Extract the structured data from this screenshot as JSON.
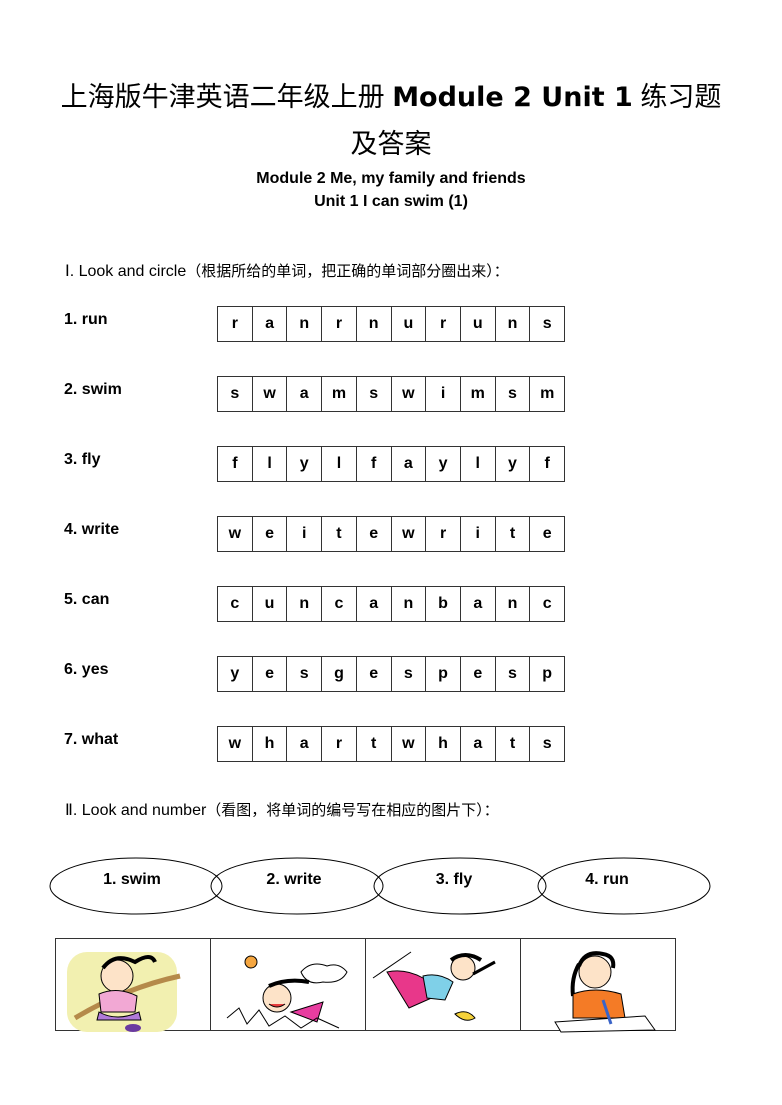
{
  "title": {
    "cn_prefix": "上海版牛津英语二年级上册",
    "latin": "Module 2 Unit 1",
    "cn_suffix": "练习题",
    "line2": "及答案"
  },
  "subtitle": {
    "module": "Module 2    Me, my family and friends",
    "unit": "Unit 1 I can swim (1)"
  },
  "section1": {
    "numeral": "Ⅰ. ",
    "instruction": "Look and circle",
    "cn_note": "（根据所给的单词，把正确的单词部分圈出来）："
  },
  "exercises": [
    {
      "label": "1. run",
      "letters": [
        "r",
        "a",
        "n",
        "r",
        "n",
        "u",
        "r",
        "u",
        "n",
        "s"
      ]
    },
    {
      "label": "2. swim",
      "letters": [
        "s",
        "w",
        "a",
        "m",
        "s",
        "w",
        "i",
        "m",
        "s",
        "m"
      ]
    },
    {
      "label": "3. fly",
      "letters": [
        "f",
        "l",
        "y",
        "l",
        "f",
        "a",
        "y",
        "l",
        "y",
        "f"
      ]
    },
    {
      "label": "4. write",
      "letters": [
        "w",
        "e",
        "i",
        "t",
        "e",
        "w",
        "r",
        "i",
        "t",
        "e"
      ]
    },
    {
      "label": "5. can",
      "letters": [
        "c",
        "u",
        "n",
        "c",
        "a",
        "n",
        "b",
        "a",
        "n",
        "c"
      ]
    },
    {
      "label": "6. yes",
      "letters": [
        "y",
        "e",
        "s",
        "g",
        "e",
        "s",
        "p",
        "e",
        "s",
        "p"
      ]
    },
    {
      "label": "7. what",
      "letters": [
        "w",
        "h",
        "a",
        "r",
        "t",
        "w",
        "h",
        "a",
        "t",
        "s"
      ]
    }
  ],
  "section2": {
    "numeral": "Ⅱ. ",
    "instruction": "Look and number",
    "cn_note": "（看图，将单词的编号写在相应的图片下）："
  },
  "ovals": [
    "1. swim",
    "2. write",
    "3. fly",
    "4. run"
  ],
  "pictures": [
    {
      "icon": "girl-running-picture"
    },
    {
      "icon": "girl-swimming-picture"
    },
    {
      "icon": "girl-flying-picture"
    },
    {
      "icon": "girl-writing-picture"
    }
  ]
}
